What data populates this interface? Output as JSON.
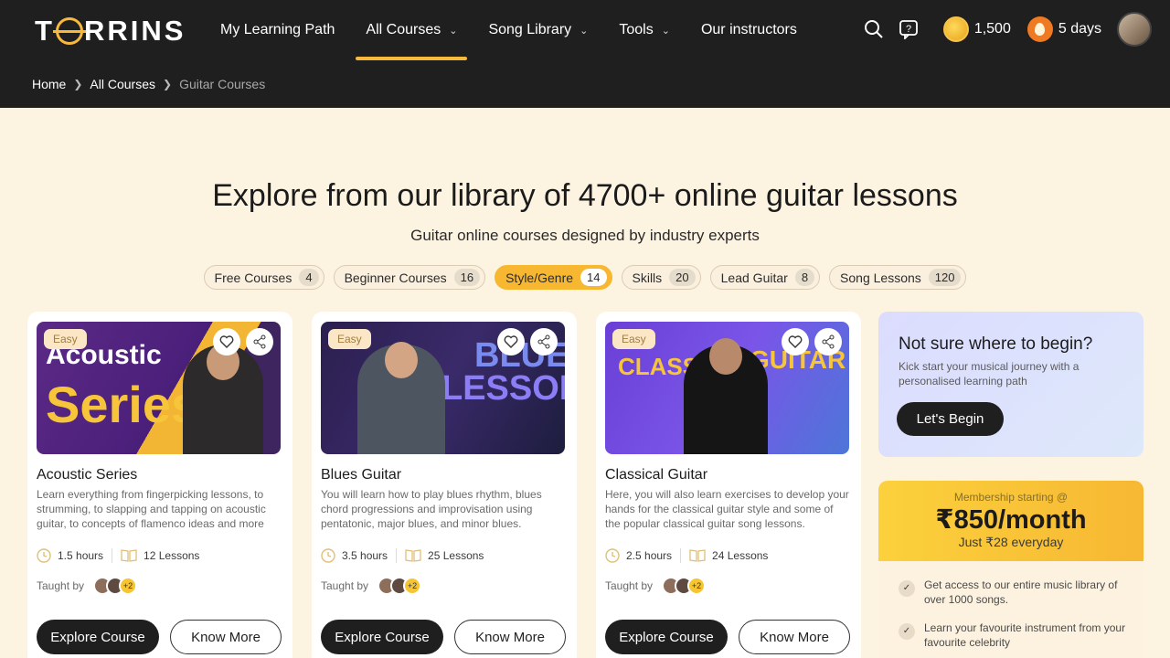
{
  "header": {
    "logo": "TORRINS",
    "nav": [
      {
        "label": "My Learning Path",
        "dropdown": false,
        "active": false
      },
      {
        "label": "All Courses",
        "dropdown": true,
        "active": true
      },
      {
        "label": "Song Library",
        "dropdown": true,
        "active": false
      },
      {
        "label": "Tools",
        "dropdown": true,
        "active": false
      },
      {
        "label": "Our instructors",
        "dropdown": false,
        "active": false
      }
    ],
    "coins": "1,500",
    "streak": "5 days"
  },
  "breadcrumb": {
    "home": "Home",
    "courses": "All Courses",
    "current": "Guitar Courses"
  },
  "hero": {
    "title": "Explore from our library of 4700+ online guitar lessons",
    "subtitle": "Guitar online courses designed by industry experts"
  },
  "filters": [
    {
      "label": "Free Courses",
      "count": "4",
      "active": false
    },
    {
      "label": "Beginner Courses",
      "count": "16",
      "active": false
    },
    {
      "label": "Style/Genre",
      "count": "14",
      "active": true
    },
    {
      "label": "Skills",
      "count": "20",
      "active": false
    },
    {
      "label": "Lead Guitar",
      "count": "8",
      "active": false
    },
    {
      "label": "Song Lessons",
      "count": "120",
      "active": false
    }
  ],
  "cards": [
    {
      "badge": "Easy",
      "thumb_line1": "Acoustic",
      "thumb_line2": "Series",
      "title": "Acoustic Series",
      "desc": "Learn everything from fingerpicking lessons, to strumming, to slapping and tapping on acoustic guitar, to concepts of flamenco ideas and more",
      "hours": "1.5 hours",
      "lessons": "12 Lessons",
      "taught_by": "Taught by",
      "more": "+2",
      "explore": "Explore Course",
      "know": "Know More"
    },
    {
      "badge": "Easy",
      "thumb_line1": "BLUES",
      "thumb_line2": "LESSONS",
      "title": "Blues Guitar",
      "desc": "You will learn how to play blues rhythm, blues chord progressions and improvisation using pentatonic, major blues, and minor blues.",
      "hours": "3.5 hours",
      "lessons": "25 Lessons",
      "taught_by": "Taught by",
      "more": "+2",
      "explore": "Explore Course",
      "know": "Know More"
    },
    {
      "badge": "Easy",
      "thumb_line1": "CLASSICAL",
      "thumb_line2": "GUITAR",
      "title": "Classical Guitar",
      "desc": "Here, you will also learn exercises to develop your hands for the classical guitar style and some of the popular classical guitar song lessons.",
      "hours": "2.5 hours",
      "lessons": "24 Lessons",
      "taught_by": "Taught by",
      "more": "+2",
      "explore": "Explore Course",
      "know": "Know More"
    }
  ],
  "begin": {
    "title": "Not sure where to begin?",
    "text": "Kick start your musical journey with a personalised learning path",
    "button": "Let's Begin"
  },
  "membership": {
    "small": "Membership starting @",
    "price": "₹850/month",
    "daily": "Just ₹28 everyday",
    "perks": [
      "Get access to our entire music library of over 1000 songs.",
      "Learn your favourite instrument from your favourite celebrity"
    ]
  },
  "colors": {
    "accent": "#f7b731",
    "dark": "#1f1f1f",
    "bg": "#fdf3e1"
  }
}
